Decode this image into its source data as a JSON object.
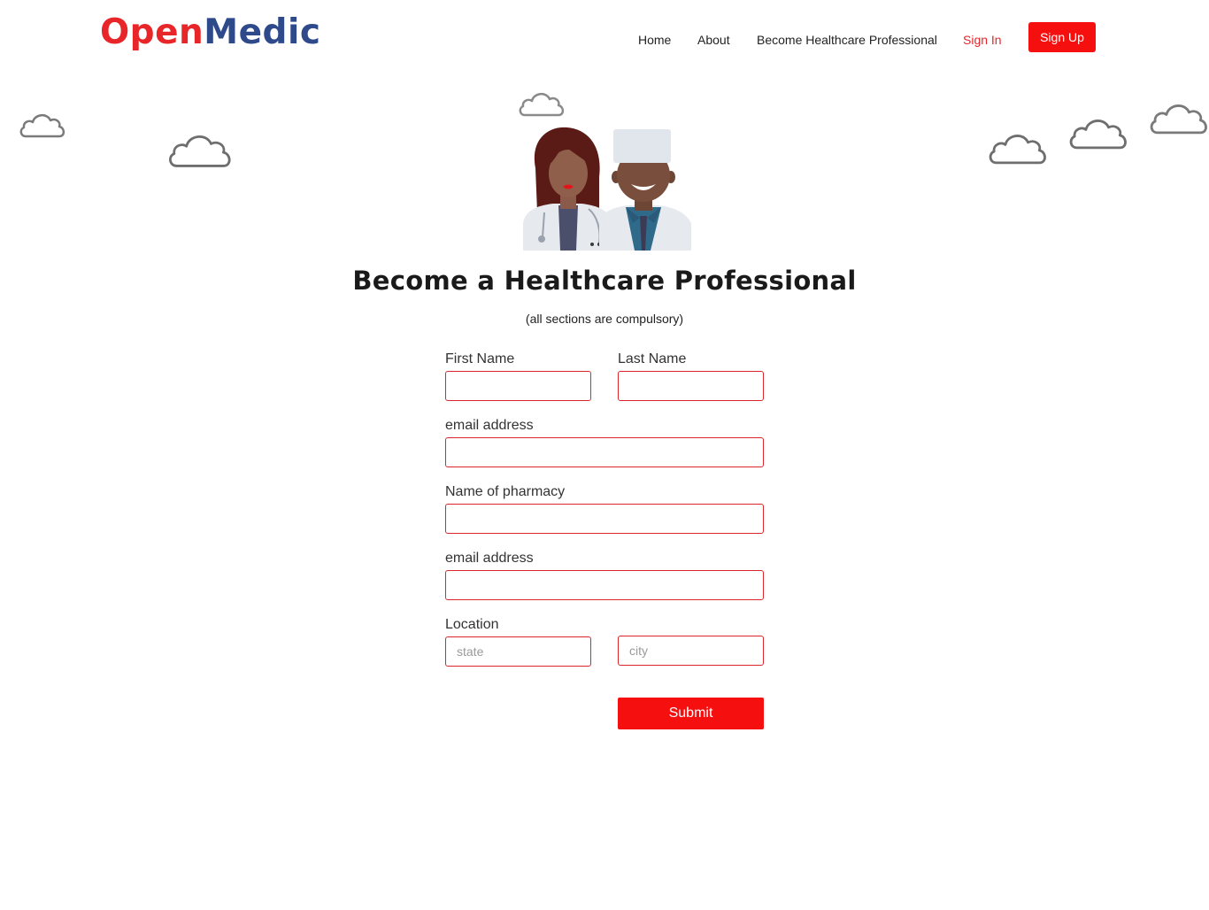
{
  "header": {
    "logo_part1": "Open",
    "logo_part2": "Medic",
    "nav": {
      "home": "Home",
      "about": "About",
      "become": "Become Healthcare Professional",
      "sign_in": "Sign In",
      "sign_up": "Sign Up"
    }
  },
  "main": {
    "title": "Become a Healthcare Professional",
    "subtitle": "(all sections are compulsory)"
  },
  "form": {
    "first_name_label": "First Name",
    "last_name_label": "Last Name",
    "email_label": "email address",
    "pharmacy_label": "Name of pharmacy",
    "email2_label": "email address",
    "location_label": "Location",
    "state_placeholder": "state",
    "city_placeholder": "city",
    "submit_label": "Submit"
  },
  "colors": {
    "brand_red": "#e8262a",
    "brand_blue": "#2f4a8a",
    "button_red": "#f50f0f",
    "field_border": "#d9262b"
  }
}
